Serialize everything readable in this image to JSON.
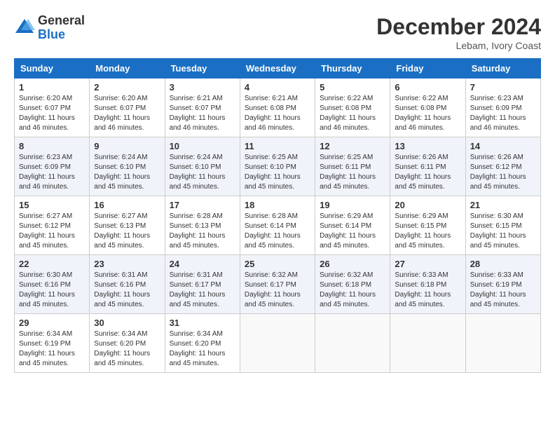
{
  "logo": {
    "general": "General",
    "blue": "Blue"
  },
  "title": {
    "month_year": "December 2024",
    "location": "Lebam, Ivory Coast"
  },
  "weekdays": [
    "Sunday",
    "Monday",
    "Tuesday",
    "Wednesday",
    "Thursday",
    "Friday",
    "Saturday"
  ],
  "weeks": [
    [
      {
        "day": "1",
        "sunrise": "6:20 AM",
        "sunset": "6:07 PM",
        "daylight": "11 hours and 46 minutes."
      },
      {
        "day": "2",
        "sunrise": "6:20 AM",
        "sunset": "6:07 PM",
        "daylight": "11 hours and 46 minutes."
      },
      {
        "day": "3",
        "sunrise": "6:21 AM",
        "sunset": "6:07 PM",
        "daylight": "11 hours and 46 minutes."
      },
      {
        "day": "4",
        "sunrise": "6:21 AM",
        "sunset": "6:08 PM",
        "daylight": "11 hours and 46 minutes."
      },
      {
        "day": "5",
        "sunrise": "6:22 AM",
        "sunset": "6:08 PM",
        "daylight": "11 hours and 46 minutes."
      },
      {
        "day": "6",
        "sunrise": "6:22 AM",
        "sunset": "6:08 PM",
        "daylight": "11 hours and 46 minutes."
      },
      {
        "day": "7",
        "sunrise": "6:23 AM",
        "sunset": "6:09 PM",
        "daylight": "11 hours and 46 minutes."
      }
    ],
    [
      {
        "day": "8",
        "sunrise": "6:23 AM",
        "sunset": "6:09 PM",
        "daylight": "11 hours and 46 minutes."
      },
      {
        "day": "9",
        "sunrise": "6:24 AM",
        "sunset": "6:10 PM",
        "daylight": "11 hours and 45 minutes."
      },
      {
        "day": "10",
        "sunrise": "6:24 AM",
        "sunset": "6:10 PM",
        "daylight": "11 hours and 45 minutes."
      },
      {
        "day": "11",
        "sunrise": "6:25 AM",
        "sunset": "6:10 PM",
        "daylight": "11 hours and 45 minutes."
      },
      {
        "day": "12",
        "sunrise": "6:25 AM",
        "sunset": "6:11 PM",
        "daylight": "11 hours and 45 minutes."
      },
      {
        "day": "13",
        "sunrise": "6:26 AM",
        "sunset": "6:11 PM",
        "daylight": "11 hours and 45 minutes."
      },
      {
        "day": "14",
        "sunrise": "6:26 AM",
        "sunset": "6:12 PM",
        "daylight": "11 hours and 45 minutes."
      }
    ],
    [
      {
        "day": "15",
        "sunrise": "6:27 AM",
        "sunset": "6:12 PM",
        "daylight": "11 hours and 45 minutes."
      },
      {
        "day": "16",
        "sunrise": "6:27 AM",
        "sunset": "6:13 PM",
        "daylight": "11 hours and 45 minutes."
      },
      {
        "day": "17",
        "sunrise": "6:28 AM",
        "sunset": "6:13 PM",
        "daylight": "11 hours and 45 minutes."
      },
      {
        "day": "18",
        "sunrise": "6:28 AM",
        "sunset": "6:14 PM",
        "daylight": "11 hours and 45 minutes."
      },
      {
        "day": "19",
        "sunrise": "6:29 AM",
        "sunset": "6:14 PM",
        "daylight": "11 hours and 45 minutes."
      },
      {
        "day": "20",
        "sunrise": "6:29 AM",
        "sunset": "6:15 PM",
        "daylight": "11 hours and 45 minutes."
      },
      {
        "day": "21",
        "sunrise": "6:30 AM",
        "sunset": "6:15 PM",
        "daylight": "11 hours and 45 minutes."
      }
    ],
    [
      {
        "day": "22",
        "sunrise": "6:30 AM",
        "sunset": "6:16 PM",
        "daylight": "11 hours and 45 minutes."
      },
      {
        "day": "23",
        "sunrise": "6:31 AM",
        "sunset": "6:16 PM",
        "daylight": "11 hours and 45 minutes."
      },
      {
        "day": "24",
        "sunrise": "6:31 AM",
        "sunset": "6:17 PM",
        "daylight": "11 hours and 45 minutes."
      },
      {
        "day": "25",
        "sunrise": "6:32 AM",
        "sunset": "6:17 PM",
        "daylight": "11 hours and 45 minutes."
      },
      {
        "day": "26",
        "sunrise": "6:32 AM",
        "sunset": "6:18 PM",
        "daylight": "11 hours and 45 minutes."
      },
      {
        "day": "27",
        "sunrise": "6:33 AM",
        "sunset": "6:18 PM",
        "daylight": "11 hours and 45 minutes."
      },
      {
        "day": "28",
        "sunrise": "6:33 AM",
        "sunset": "6:19 PM",
        "daylight": "11 hours and 45 minutes."
      }
    ],
    [
      {
        "day": "29",
        "sunrise": "6:34 AM",
        "sunset": "6:19 PM",
        "daylight": "11 hours and 45 minutes."
      },
      {
        "day": "30",
        "sunrise": "6:34 AM",
        "sunset": "6:20 PM",
        "daylight": "11 hours and 45 minutes."
      },
      {
        "day": "31",
        "sunrise": "6:34 AM",
        "sunset": "6:20 PM",
        "daylight": "11 hours and 45 minutes."
      },
      null,
      null,
      null,
      null
    ]
  ]
}
